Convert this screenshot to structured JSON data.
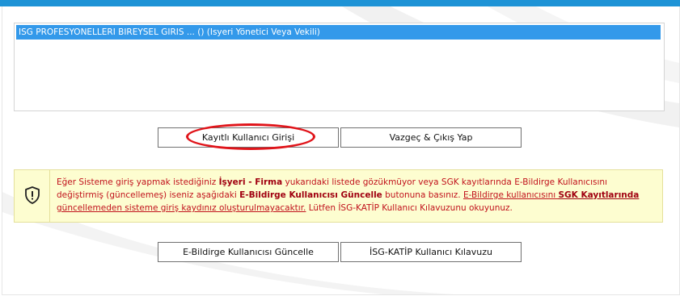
{
  "list": {
    "items": [
      "ISG PROFESYONELLERI BIREYSEL GIRIS ... () (Isyeri Yönetici Veya Vekili)"
    ]
  },
  "buttons": {
    "login": "Kayıtlı Kullanıcı Girişi",
    "cancel": "Vazgeç & Çıkış Yap",
    "update": "E-Bildirge Kullanıcısı Güncelle",
    "guide": "İSG-KATİP Kullanıcı Kılavuzu"
  },
  "notice": {
    "icon": "shield-warning-icon",
    "t1": "Eğer Sisteme giriş yapmak istediğiniz ",
    "b1": "İşyeri - Firma",
    "t2": " yukarıdaki listede gözükmüyor veya SGK kayıtlarında E-Bildirge Kullanıcısını değiştirmiş (güncellemeş) iseniz aşağıdaki ",
    "b2": "E-Bildirge Kullanıcısı Güncelle",
    "t3": " butonuna basınız. ",
    "u1": "E-Bildirge kullanıcısını ",
    "ub": "SGK Kayıtlarında",
    "u2": " güncellemeden sisteme giriş kaydınız oluşturulmayacaktır.",
    "t4": " Lütfen İSG-KATİP Kullanıcı Kılavuzunu okuyunuz."
  },
  "colors": {
    "accent": "#1e93d6",
    "selection": "#3399ea",
    "highlight_circle": "#e0141a",
    "notice_bg": "#fdfdd0",
    "notice_text": "#c1121c"
  }
}
